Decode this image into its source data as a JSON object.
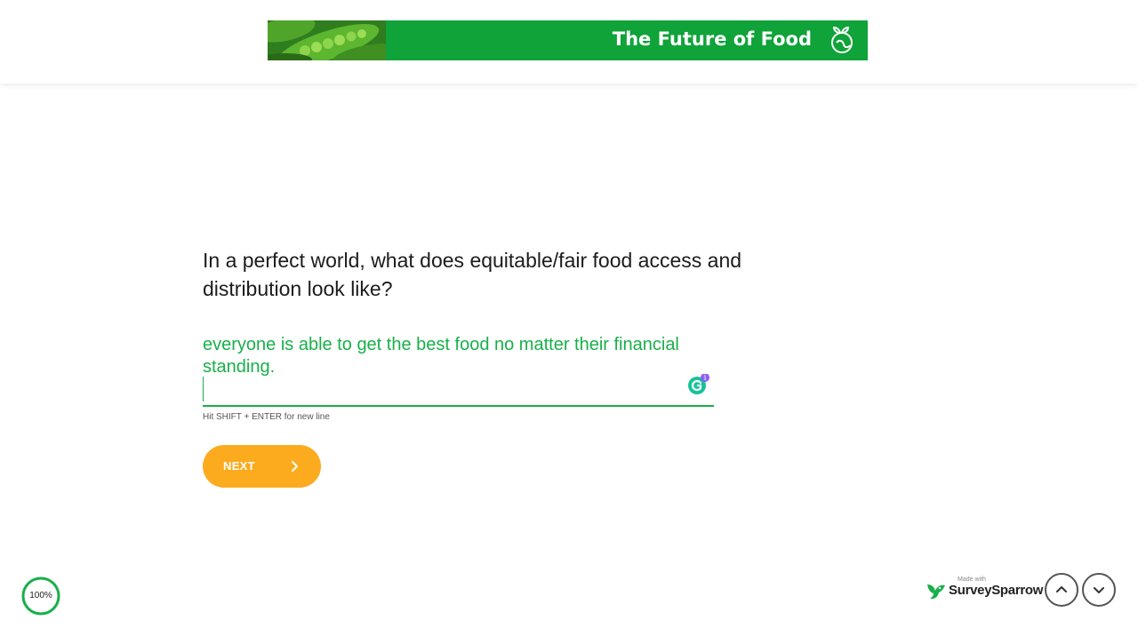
{
  "banner": {
    "title": "The Future of Food",
    "background_color": "#0fa33a",
    "logo_icon": "sprout-globe-icon",
    "image": "peas-pod-image"
  },
  "question": {
    "text": "In a perfect world, what does equitable/fair food access and distribution look like?"
  },
  "answer": {
    "value": "everyone is able to get the best food no matter their financial standing.",
    "color": "#18b04a",
    "grammarly_badge_count": "1"
  },
  "hint": "Hit SHIFT + ENTER for new line",
  "next_button": {
    "label": "NEXT",
    "color": "#fcab1e",
    "icon": "chevron-right-icon"
  },
  "progress": {
    "label": "100%",
    "percent": 100,
    "color": "#18b04a"
  },
  "branding": {
    "small_text": "Made with",
    "name": "SurveySparrow",
    "icon": "surveysparrow-logo-icon"
  },
  "navigation": {
    "up_icon": "chevron-up-icon",
    "down_icon": "chevron-down-icon"
  }
}
